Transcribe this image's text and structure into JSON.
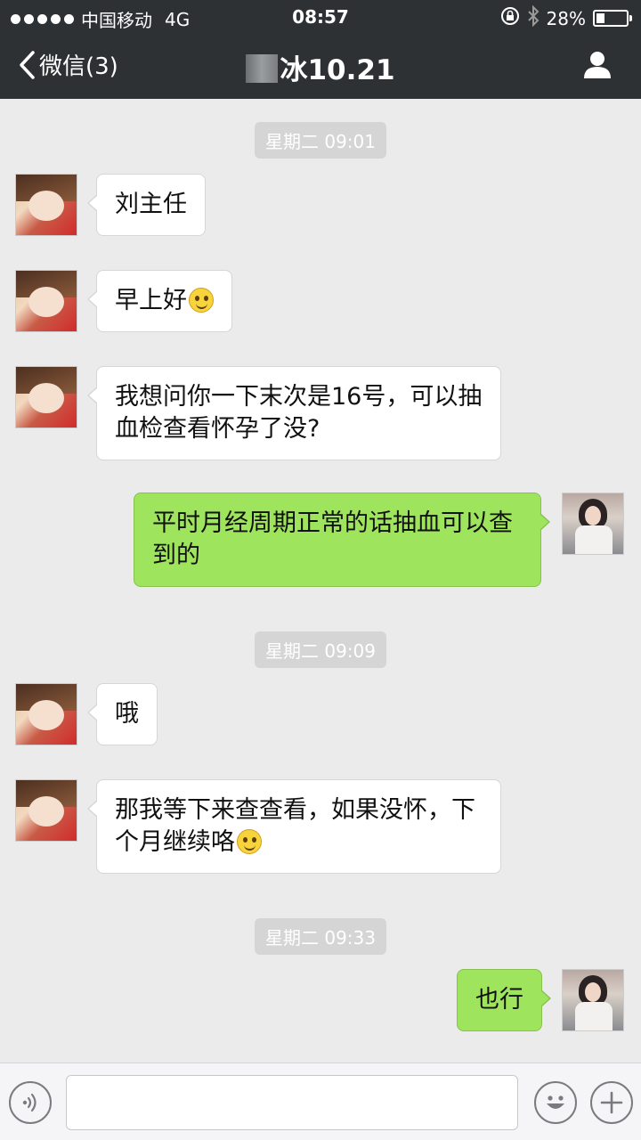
{
  "status_bar": {
    "carrier": "中国移动",
    "network": "4G",
    "time": "08:57",
    "battery_text": "28%",
    "battery_level": 0.28
  },
  "nav": {
    "back_label": "微信(3)",
    "title": "冰10.21"
  },
  "timestamps": [
    "星期二 09:01",
    "星期二 09:09",
    "星期二 09:33"
  ],
  "messages": [
    {
      "from": "contact",
      "text": "刘主任"
    },
    {
      "from": "contact",
      "text": "早上好",
      "emoji": "smile"
    },
    {
      "from": "contact",
      "text": "我想问你一下末次是16号，可以抽血检查看怀孕了没?"
    },
    {
      "from": "me",
      "text": "平时月经周期正常的话抽血可以查到的"
    },
    {
      "from": "contact",
      "text": "哦"
    },
    {
      "from": "contact",
      "text": "那我等下来查查看，如果没怀，下个月继续咯",
      "emoji": "smile"
    },
    {
      "from": "me",
      "text": "也行"
    }
  ],
  "input": {
    "value": "",
    "placeholder": ""
  },
  "colors": {
    "nav_bg": "#2e3134",
    "chat_bg": "#ebebeb",
    "outgoing_bubble": "#9fe45d",
    "incoming_bubble": "#ffffff"
  }
}
